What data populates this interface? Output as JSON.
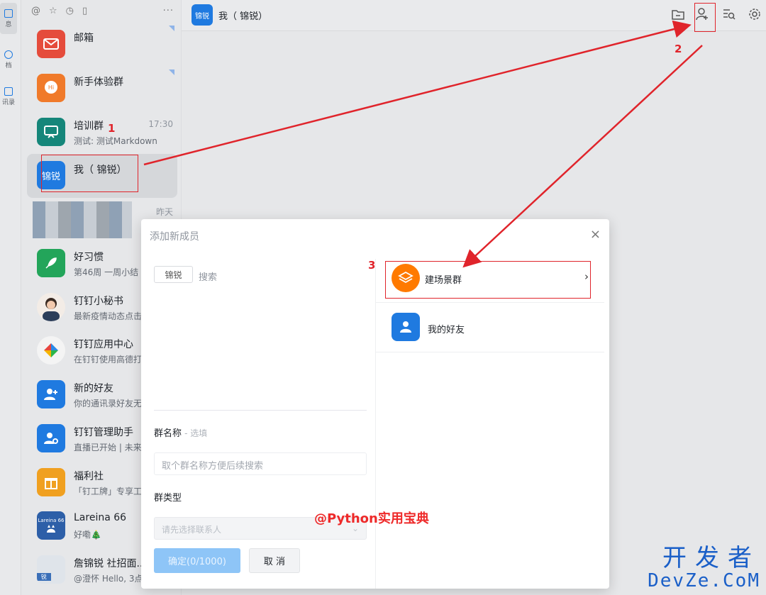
{
  "rail": {
    "items": [
      {
        "label": "息"
      },
      {
        "label": "档"
      },
      {
        "label": "讯录"
      }
    ]
  },
  "conversations": [
    {
      "name": "邮箱",
      "sub": "",
      "time": "",
      "avatar_text": "",
      "color": "#e54c3c",
      "icon": "mail-icon",
      "unread_mark": true
    },
    {
      "name": "新手体验群",
      "sub": "",
      "time": "",
      "avatar_text": "",
      "color": "#f07a2a",
      "icon": "hi-bubble-icon",
      "unread_mark": true
    },
    {
      "name": "培训群",
      "sub": "测试: 测试Markdown",
      "time": "17:30",
      "avatar_text": "",
      "color": "#15867a",
      "icon": "presentation-icon"
    },
    {
      "name": "我（  锦锐）",
      "sub": "",
      "time": "",
      "avatar_text": "锦锐",
      "color": "#1f7ae0",
      "icon": "",
      "selected": true
    },
    {
      "name": "",
      "sub": "",
      "time": "昨天",
      "avatar_text": "",
      "color": "#9aa0a8",
      "icon": "blurred-avatar",
      "blurred": true
    },
    {
      "name": "好习惯",
      "sub": "第46周 一周小结",
      "time": "",
      "avatar_text": "",
      "color": "#23a55a",
      "icon": "rocket-icon"
    },
    {
      "name": "钉钉小秘书",
      "sub": "最新疫情动态点击",
      "time": "",
      "avatar_text": "",
      "color": "#f3ece6",
      "icon": "person-photo-icon"
    },
    {
      "name": "钉钉应用中心",
      "sub": "在钉钉使用高德打",
      "time": "",
      "avatar_text": "",
      "color": "#f4f4f4",
      "icon": "colorful-diamond-icon"
    },
    {
      "name": "新的好友",
      "sub": "你的通讯录好友无",
      "time": "",
      "avatar_text": "",
      "color": "#1f7ae0",
      "icon": "add-friend-icon"
    },
    {
      "name": "钉钉管理助手",
      "sub": "直播已开始 | 未来",
      "time": "",
      "avatar_text": "",
      "color": "#1f7ae0",
      "icon": "admin-user-icon"
    },
    {
      "name": "福利社",
      "sub": "「钉工牌」专享工",
      "time": "",
      "avatar_text": "",
      "color": "#f0a020",
      "icon": "gift-icon"
    },
    {
      "name": "Lareina 66",
      "sub": "好嘞🎄",
      "time": "",
      "avatar_text": "Lareina 66",
      "color": "#2d5fa8",
      "icon": "cat-photo-icon"
    },
    {
      "name": "詹锦锐 社招面...",
      "sub": "@澄怀 Hello, 3点",
      "time": "",
      "avatar_text": "锐",
      "color": "#3a6fb8",
      "icon": "group-photo-icon"
    }
  ],
  "header": {
    "avatar_text": "锦锐",
    "title": "我（  锦锐）"
  },
  "dialog": {
    "title": "添加新成员",
    "close": "×",
    "search_chip": "锦锐",
    "search_label": "搜索",
    "group_name_label": "群名称",
    "group_name_optional": "- 选填",
    "group_name_placeholder": "取个群名称方便后续搜索",
    "group_type_label": "群类型",
    "group_type_placeholder": "请先选择联系人",
    "confirm_button": "确定(0/1000)",
    "cancel_button": "取 消",
    "options": [
      {
        "label": "建场景群",
        "icon": "layers-icon",
        "color": "#ff7a00",
        "chevron": "›"
      },
      {
        "label": "我的好友",
        "icon": "user-icon",
        "color": "#1f7ae0",
        "chevron": ""
      }
    ]
  },
  "annotations": {
    "step1": "1",
    "step2": "2",
    "step3": "3",
    "color": "#e0242b"
  },
  "watermarks": {
    "python": "@Python实用宝典",
    "site_line1": "开发者",
    "site_line2": "DevZe.CoM"
  }
}
